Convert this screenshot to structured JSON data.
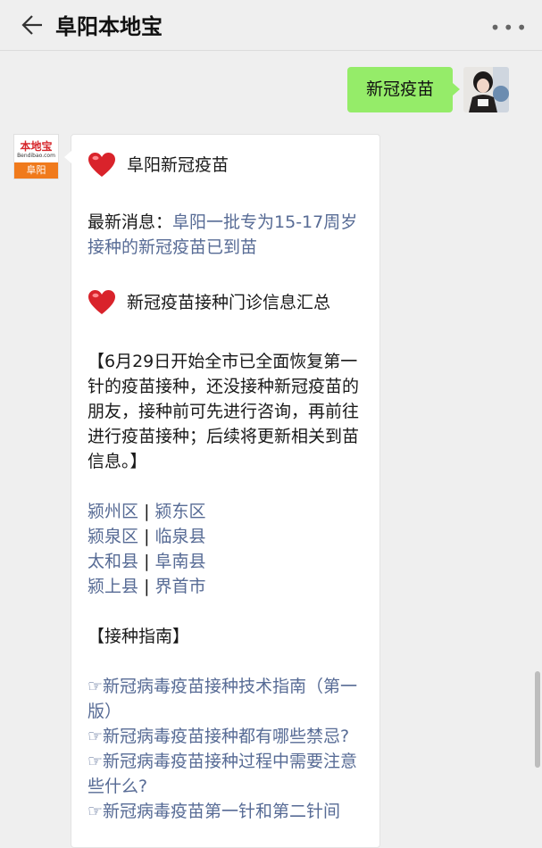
{
  "header": {
    "title": "阜阳本地宝",
    "back_icon": "back-arrow-icon",
    "more_icon": "more-dots-icon"
  },
  "user_message": {
    "text": "新冠疫苗"
  },
  "bot": {
    "avatar": {
      "brand": "本地宝",
      "domain": "Bendibao.com",
      "city": "阜阳"
    },
    "heading1": "阜阳新冠疫苗",
    "news_label": "最新消息：",
    "news_link": "阜阳一批专为15-17周岁接种的新冠疫苗已到苗",
    "heading2": "新冠疫苗接种门诊信息汇总",
    "notice": "【6月29日开始全市已全面恢复第一针的疫苗接种，还没接种新冠疫苗的朋友，接种前可先进行咨询，再前往进行疫苗接种；后续将更新相关到苗信息。】",
    "districts": [
      [
        "颍州区",
        "颍东区"
      ],
      [
        "颍泉区",
        "临泉县"
      ],
      [
        "太和县",
        "阜南县"
      ],
      [
        "颍上县",
        "界首市"
      ]
    ],
    "separator": "|",
    "guide_heading": "【接种指南】",
    "guide_links": [
      "☞新冠病毒疫苗接种技术指南（第一版）",
      "☞新冠病毒疫苗接种都有哪些禁忌?",
      "☞新冠病毒疫苗接种过程中需要注意些什么?",
      "☞新冠病毒疫苗第一针和第二针间"
    ],
    "heart_icon": "heart-icon"
  }
}
